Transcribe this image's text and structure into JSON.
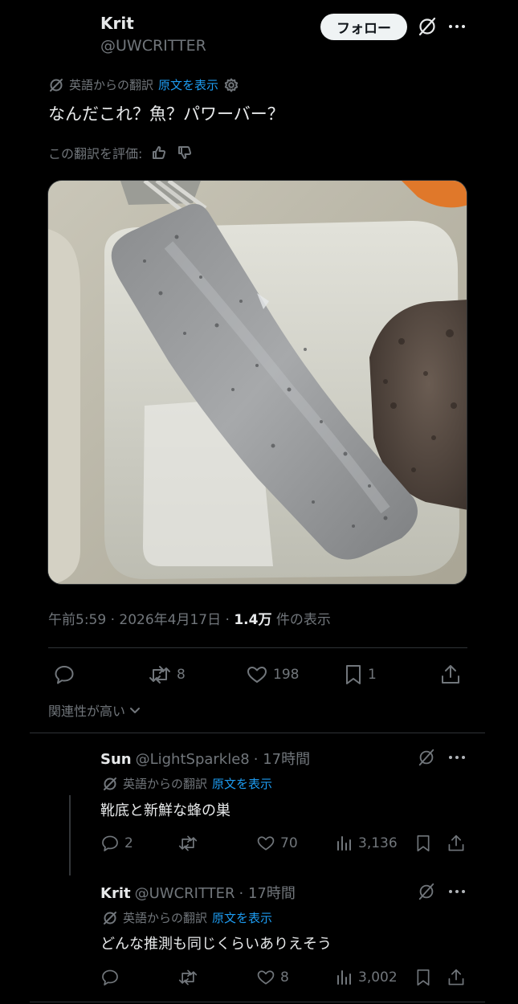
{
  "post": {
    "author_name": "Krit",
    "author_handle": "@UWCRITTER",
    "follow_label": "フォロー",
    "translated_from": "英語からの翻訳",
    "show_original": "原文を表示",
    "text": "なんだこれ？魚？パワーバー？",
    "rate_translation": "この翻訳を評価:",
    "time": "午前5:59",
    "date": "2026年4月17日",
    "views_count": "1.4万",
    "views_label": "件の表示",
    "retweets": "8",
    "likes": "198",
    "bookmarks": "1"
  },
  "sort": {
    "label": "関連性が高い"
  },
  "replies": [
    {
      "name": "Sun",
      "handle": "@LightSparkle8",
      "time": "· 17時間",
      "translated_from": "英語からの翻訳",
      "show_original": "原文を表示",
      "text": "靴底と新鮮な蜂の巣",
      "replies": "2",
      "likes": "70",
      "views": "3,136"
    },
    {
      "name": "Krit",
      "handle": "@UWCRITTER",
      "time": "· 17時間",
      "translated_from": "英語からの翻訳",
      "show_original": "原文を表示",
      "text": "どんな推測も同じくらいありえそう",
      "replies": "",
      "likes": "8",
      "views": "3,002"
    }
  ],
  "colors": {
    "background": "#000000",
    "text": "#e7e9ea",
    "muted": "#71767b",
    "link": "#1d9bf0",
    "divider": "#2f3336"
  }
}
